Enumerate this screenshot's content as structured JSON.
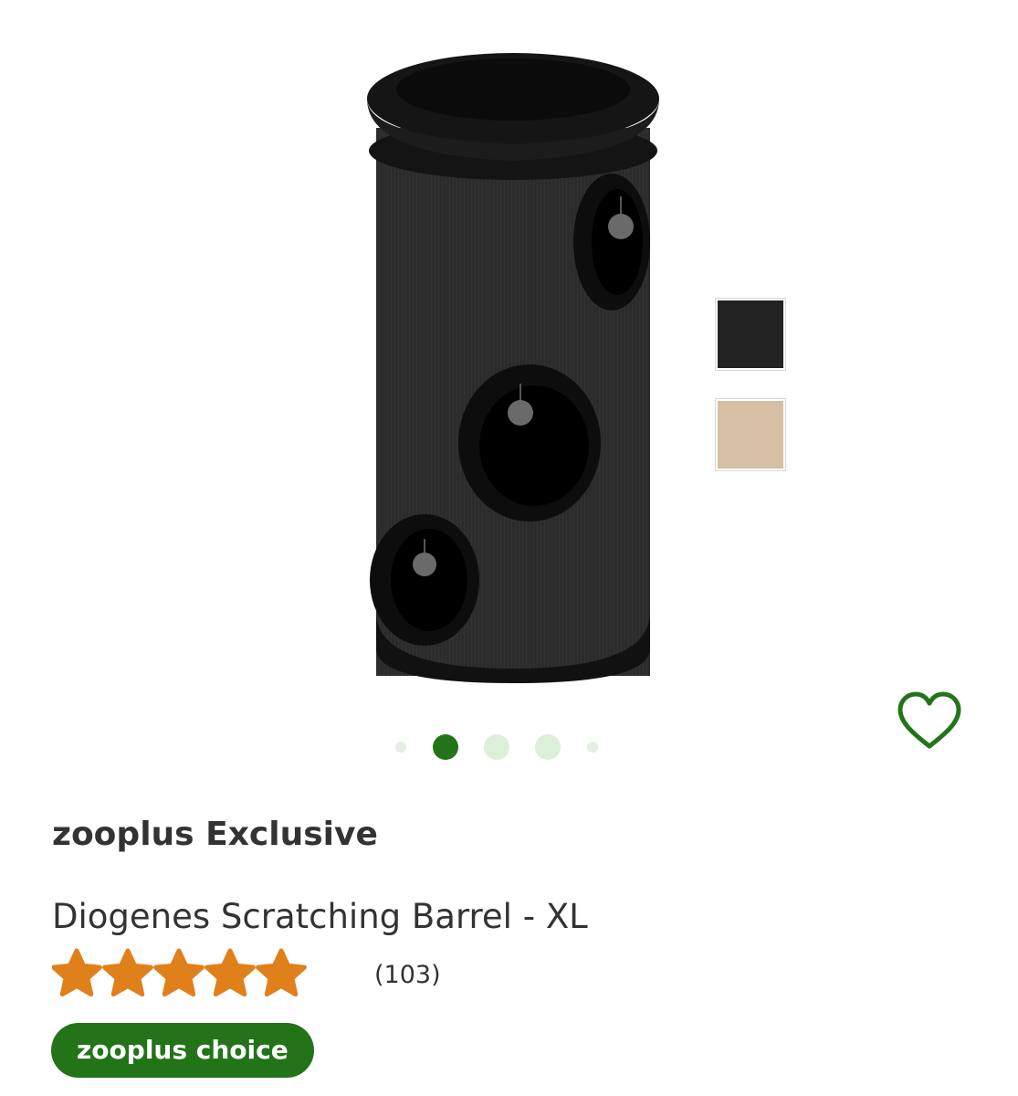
{
  "product": {
    "brand": "zooplus Exclusive",
    "title": "Diogenes Scratching Barrel - XL",
    "rating": 5,
    "rating_max": 5,
    "review_count": "(103)",
    "badge": "zooplus choice",
    "image_alt": "Diogenes Scratching Barrel - XL"
  },
  "color_options": [
    {
      "name": "black",
      "color": "#222222",
      "selected": true
    },
    {
      "name": "beige",
      "color": "#d6bfa2",
      "selected": false
    }
  ],
  "gallery": {
    "total_images": 5,
    "active_index": 1
  },
  "colors": {
    "brand_green": "#237419",
    "star_orange": "#e0801a",
    "dot_active": "#237419",
    "dot_inactive": "#dcefd9",
    "dot_edge": "#e4eee2"
  },
  "icons": {
    "favorite": "heart-outline-icon",
    "rating": "star-icon"
  }
}
